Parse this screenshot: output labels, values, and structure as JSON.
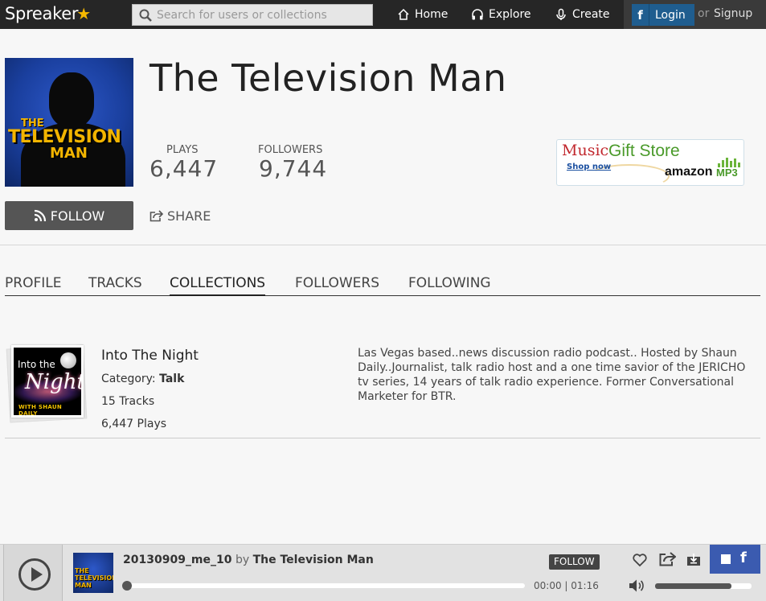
{
  "nav": {
    "logo": "Spreaker",
    "search_placeholder": "Search for users or collections",
    "home": "Home",
    "explore": "Explore",
    "create": "Create",
    "login": "Login",
    "or": "or",
    "signup": "Signup"
  },
  "profile": {
    "name": "The Television Man",
    "cover_text": [
      "THE",
      "TELEVISION",
      "MAN"
    ],
    "plays_label": "PLAYS",
    "plays_value": "6,447",
    "followers_label": "FOLLOWERS",
    "followers_value": "9,744",
    "follow_label": "FOLLOW",
    "share_label": "SHARE"
  },
  "ad": {
    "music": "Music",
    "gift_store": "Gift Store",
    "shop_now": "Shop now",
    "amazon": "amazon",
    "mp3": "MP3"
  },
  "tabs": [
    "PROFILE",
    "TRACKS",
    "COLLECTIONS",
    "FOLLOWERS",
    "FOLLOWING"
  ],
  "active_tab": "COLLECTIONS",
  "collection": {
    "title": "Into The Night",
    "category_label": "Category:",
    "category": "Talk",
    "tracks": "15 Tracks",
    "plays": "6,447 Plays",
    "thumb_into": "Into the",
    "thumb_night": "Night",
    "thumb_with": "WITH SHAUN DAILY",
    "description": "Las Vegas based..news discussion radio podcast.. Hosted by Shaun Daily..Journalist, talk radio host and a one time savior of the JERICHO tv series, 14 years of talk radio experience. Former Conversational Marketer for BTR."
  },
  "player": {
    "track_title": "20130909_me_10",
    "by": "by",
    "author": "The Television Man",
    "follow": "FOLLOW",
    "time": "00:00 | 01:16",
    "volume_level": 0.79,
    "progress": 0,
    "fb": "f"
  },
  "colors": {
    "topbar": "#262626",
    "accent_star": "#f5b800",
    "facebook": "#1f5d8f",
    "follow_button": "#555555"
  }
}
